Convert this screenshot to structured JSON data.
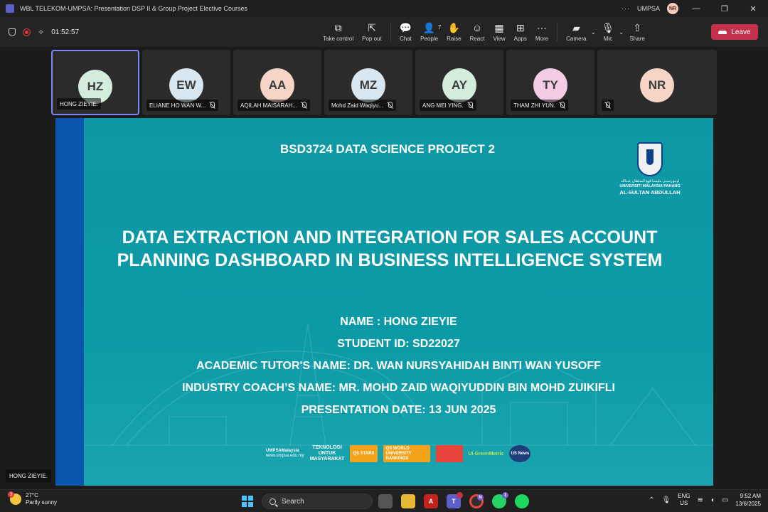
{
  "window": {
    "title": "WBL TELEKOM-UMPSA: Presentation DSP II & Group Project Elective Courses",
    "more": "···",
    "org": "UMPSA",
    "user_initials": "NR",
    "minimize": "—",
    "restore": "❐",
    "close": "✕"
  },
  "toolbar": {
    "timer": "01:52:57",
    "tools": [
      {
        "label": "Take control",
        "icon": "take-control-icon",
        "glyph": "⧉"
      },
      {
        "label": "Pop out",
        "icon": "pop-out-icon",
        "glyph": "⇱"
      },
      {
        "label": "Chat",
        "icon": "chat-icon",
        "glyph": "💬"
      },
      {
        "label": "People",
        "icon": "people-icon",
        "glyph": "👤",
        "count": "7"
      },
      {
        "label": "Raise",
        "icon": "raise-hand-icon",
        "glyph": "✋"
      },
      {
        "label": "React",
        "icon": "react-icon",
        "glyph": "☺"
      },
      {
        "label": "View",
        "icon": "view-icon",
        "glyph": "▦"
      },
      {
        "label": "Apps",
        "icon": "apps-icon",
        "glyph": "⊞"
      },
      {
        "label": "More",
        "icon": "more-icon",
        "glyph": "···"
      },
      {
        "label": "Camera",
        "icon": "camera-off-icon",
        "glyph": "▰"
      },
      {
        "label": "Mic",
        "icon": "mic-off-icon",
        "glyph": "🎙"
      },
      {
        "label": "Share",
        "icon": "share-icon",
        "glyph": "⇧"
      }
    ],
    "leave_label": "Leave"
  },
  "participants": [
    {
      "initials": "HZ",
      "name": "HONG ZIEYIE.",
      "color": "#d3ecdc",
      "muted": false,
      "active": true
    },
    {
      "initials": "EW",
      "name": "ELIANE HO WAN W...",
      "color": "#d7e6f0",
      "muted": true,
      "active": false
    },
    {
      "initials": "AA",
      "name": "AQILAH MAISARAH...",
      "color": "#f6d4c6",
      "muted": true,
      "active": false
    },
    {
      "initials": "MZ",
      "name": "Mohd Zaid Waqiyu...",
      "color": "#d7e6f0",
      "muted": true,
      "active": false
    },
    {
      "initials": "AY",
      "name": "ANG MEI YING.",
      "color": "#d3ecdc",
      "muted": true,
      "active": false
    },
    {
      "initials": "TY",
      "name": "THAM ZHI YUN.",
      "color": "#f4cde4",
      "muted": true,
      "active": false
    },
    {
      "initials": "NR",
      "name": "",
      "color": "#f6d4c6",
      "muted": true,
      "active": false
    }
  ],
  "slide": {
    "course": "BSD3724 DATA SCIENCE PROJECT 2",
    "title_line1": "DATA EXTRACTION AND INTEGRATION FOR SALES ACCOUNT",
    "title_line2": "PLANNING DASHBOARD IN BUSINESS INTELLIGENCE SYSTEM",
    "name": "NAME : HONG ZIEYIE",
    "student_id": "STUDENT ID: SD22027",
    "academic_tutor": "ACADEMIC TUTOR'S NAME: DR. WAN NURSYAHIDAH BINTI WAN YUSOFF",
    "industry_coach": "INDUSTRY COACH’S NAME: MR. MOHD ZAID WAQIYUDDIN BIN MOHD ZUIKIFLI",
    "presentation_date": "PRESENTATION DATE: 13 JUN 2025",
    "logo": {
      "arabic": "اونيۏرسيتي مليسيا ڤهڠ السلطان عبدالله",
      "line1": "UNIVERSITI MALAYSIA PAHANG",
      "line2": "AL-SULTAN ABDULLAH"
    },
    "footer": {
      "social_handle": "UMPSAMalaysia",
      "website": "www.umpsa.edu.my",
      "slogan_1": "TEKNOLOGI",
      "slogan_2": "UNTUK",
      "slogan_3": "MASYARAKAT",
      "qs_stars": "QS STARS",
      "qs_wur": "QS WORLD UNIVERSITY RANKINGS",
      "ui_green": "UI GreenMetric",
      "usnews": "US News"
    }
  },
  "presenter_tag": "HONG ZIEYIE.",
  "taskbar": {
    "weather_temp": "27°C",
    "weather_desc": "Partly sunny",
    "weather_badge": "3",
    "search_label": "Search",
    "lang_1": "ENG",
    "lang_2": "US",
    "time": "9:52 AM",
    "date": "13/6/2025",
    "chrome_badge": "N",
    "whatsapp_badge": "1"
  }
}
